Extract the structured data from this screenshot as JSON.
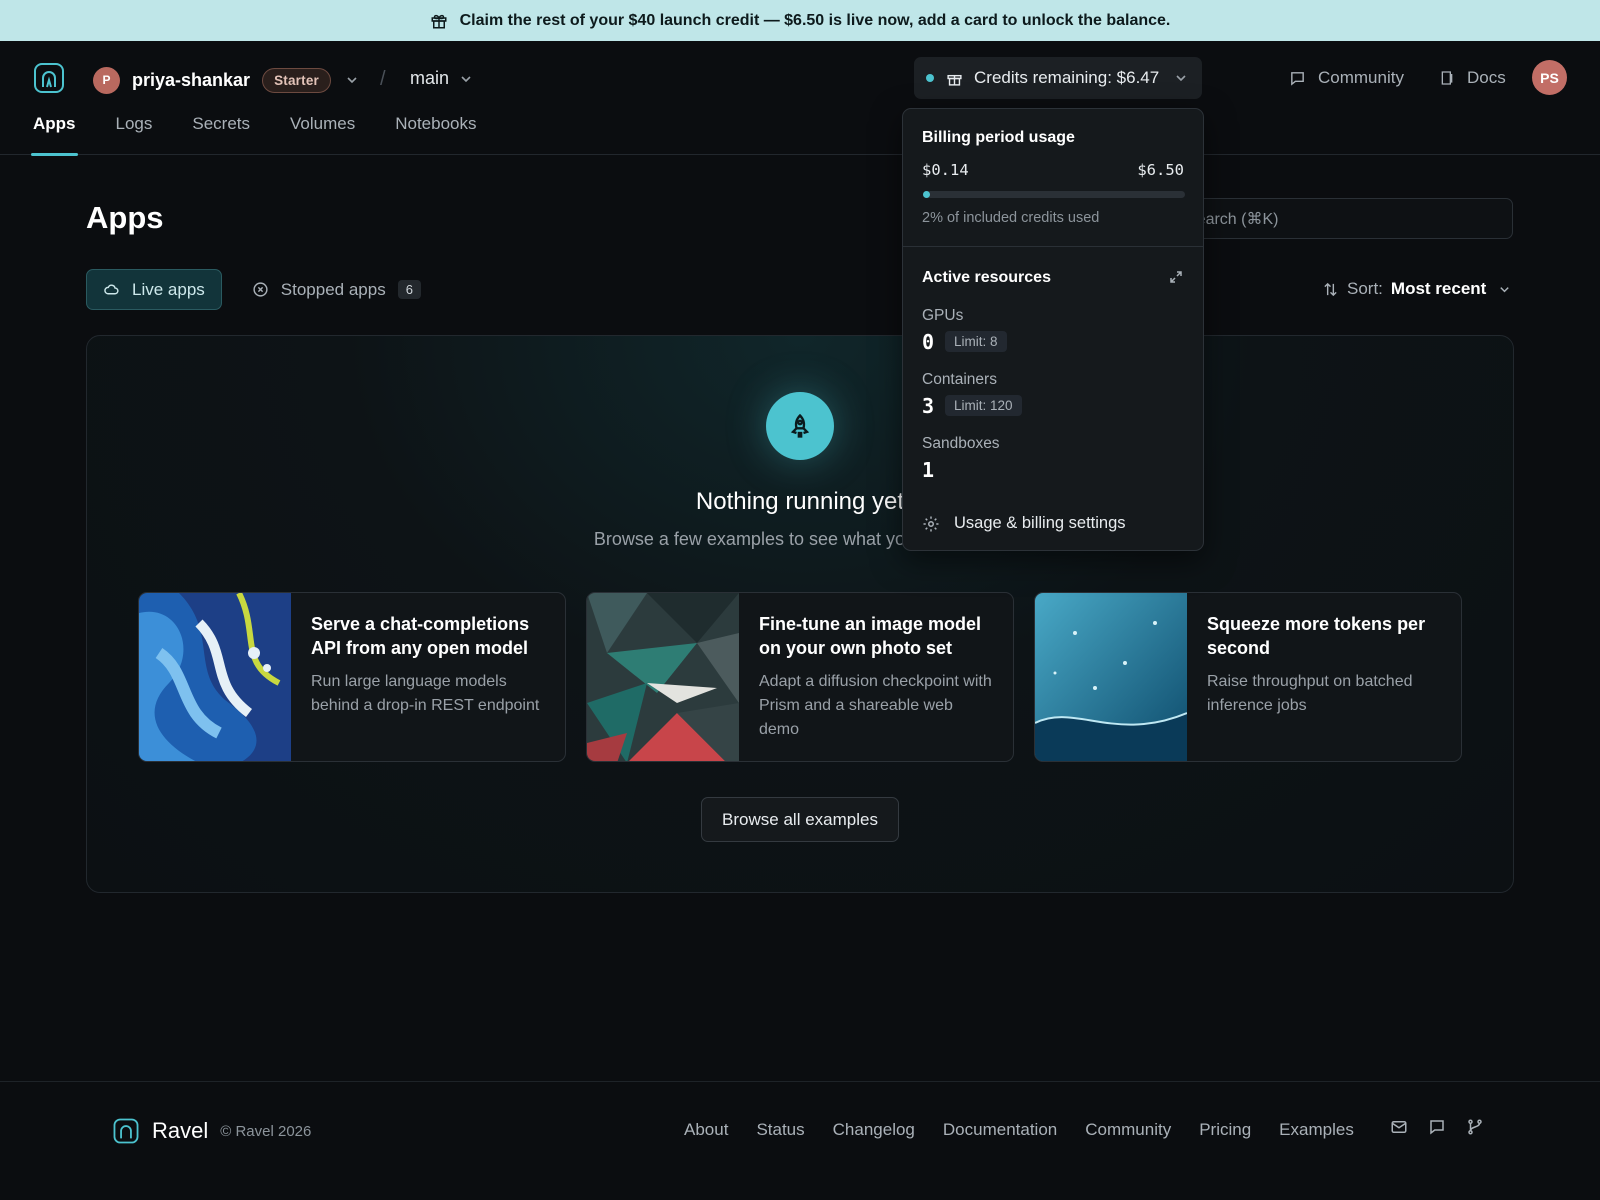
{
  "banner": {
    "text": "Claim the rest of your $40 launch credit — $6.50 is live now, add a card to unlock the balance.",
    "icon": "gift-icon"
  },
  "header": {
    "account": {
      "initial": "P",
      "name": "priya-shankar",
      "plan": "Starter"
    },
    "environment": "main",
    "credits_label": "Credits remaining: $6.47",
    "links": [
      {
        "label": "Community",
        "icon": "chat-icon"
      },
      {
        "label": "Docs",
        "icon": "book-icon"
      }
    ],
    "user_initials": "PS"
  },
  "tabs": [
    {
      "label": "Apps",
      "active": true
    },
    {
      "label": "Logs"
    },
    {
      "label": "Secrets"
    },
    {
      "label": "Volumes"
    },
    {
      "label": "Notebooks"
    }
  ],
  "main": {
    "title": "Apps",
    "search_placeholder": "Search (⌘K)",
    "filters": [
      {
        "label": "Live apps",
        "active": true
      },
      {
        "label": "Stopped apps",
        "count": "6"
      }
    ],
    "sort_label": "Sort:",
    "sort_value": "Most recent",
    "empty_title": "Nothing running yet",
    "empty_subtitle": "Browse a few examples to see what you could build",
    "cards": [
      {
        "title": "Serve a chat-completions API from any open model",
        "desc": "Run large language models behind a drop-in REST endpoint"
      },
      {
        "title": "Fine-tune an image model on your own photo set",
        "desc": "Adapt a diffusion checkpoint with Prism and a shareable web demo"
      },
      {
        "title": "Squeeze more tokens per second",
        "desc": "Raise throughput on batched inference jobs"
      }
    ],
    "browse_label": "Browse all examples"
  },
  "dropdown": {
    "usage_title": "Billing period usage",
    "used": "$0.14",
    "total": "$6.50",
    "usage_fraction": 0.02,
    "usage_text": "2% of included credits used",
    "resources_title": "Active resources",
    "resources": [
      {
        "label": "GPUs",
        "value": "0",
        "limit": "Limit: 8"
      },
      {
        "label": "Containers",
        "value": "3",
        "limit": "Limit: 120"
      },
      {
        "label": "Sandboxes",
        "value": "1"
      }
    ],
    "settings_label": "Usage & billing settings"
  },
  "footer": {
    "brand": "Ravel",
    "copyright": "© Ravel 2026",
    "links": [
      "About",
      "Status",
      "Changelog",
      "Documentation",
      "Community",
      "Pricing",
      "Examples"
    ]
  },
  "colors": {
    "accent": "#4cc3cf",
    "banner": "#bfe6e8",
    "background": "#0b0d10"
  }
}
